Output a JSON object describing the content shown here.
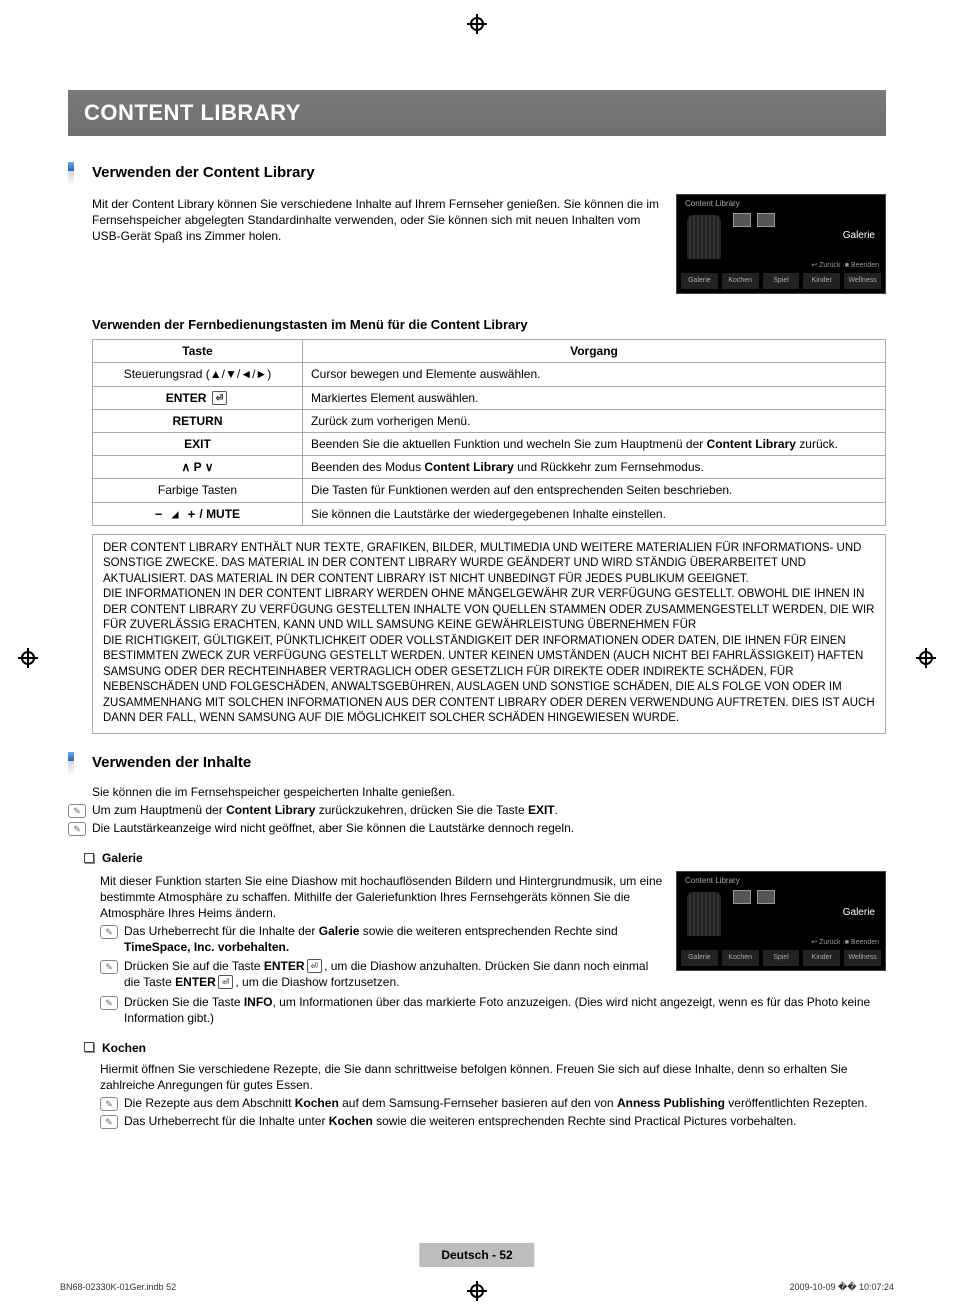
{
  "banner": "CONTENT LIBRARY",
  "sec1": {
    "title": "Verwenden der Content Library",
    "intro": "Mit der Content Library können Sie verschiedene Inhalte auf Ihrem Fernseher genießen. Sie können die im Fernsehspeicher abgelegten Standardinhalte verwenden, oder Sie können sich mit neuen Inhalten vom USB-Gerät Spaß ins Zimmer holen.",
    "tv_label": "Galerie",
    "tv_top_title": "Content Library",
    "tv_items": [
      "Galerie",
      "Kochen",
      "Spiel",
      "Kinder",
      "Wellness"
    ],
    "tv_meta": "↩ Zurück   ·■ Beenden"
  },
  "sub_heading_remote": "Verwenden der Fernbedienungstasten im Menü für die Content Library",
  "table": {
    "head": [
      "Taste",
      "Vorgang"
    ],
    "rows": [
      {
        "k": "Steuerungsrad (▲/▼/◄/►)",
        "v": "Cursor bewegen und Elemente auswählen."
      },
      {
        "k": "ENTER ⏎",
        "v": "Markiertes Element auswählen."
      },
      {
        "k": "RETURN",
        "v": "Zurück zum vorherigen Menü."
      },
      {
        "k": "EXIT",
        "v_html": [
          "Beenden Sie die aktuellen Funktion und wecheln Sie zum Hauptmenü der ",
          "Content Library",
          " zurück."
        ]
      },
      {
        "k": "∧ P ∨",
        "v_html": [
          "Beenden des Modus ",
          "Content Library",
          " und Rückkehr zum Fernsehmodus."
        ]
      },
      {
        "k": "Farbige Tasten",
        "v": "Die Tasten für Funktionen werden auf den entsprechenden Seiten beschrieben."
      },
      {
        "k": "− ◢ + / MUTE",
        "v": "Sie können die Lautstärke der wiedergegebenen Inhalte einstellen."
      }
    ]
  },
  "legal": "DER CONTENT LIBRARY ENTHÄLT NUR TEXTE, GRAFIKEN, BILDER, MULTIMEDIA UND WEITERE MATERIALIEN FÜR INFORMATIONS- UND SONSTIGE ZWECKE. DAS MATERIAL IN DER CONTENT LIBRARY WURDE GEÄNDERT UND WIRD STÄNDIG ÜBERARBEITET UND AKTUALISIERT. DAS MATERIAL IN DER CONTENT LIBRARY IST NICHT UNBEDINGT FÜR JEDES PUBLIKUM GEEIGNET.\nDIE INFORMATIONEN IN DER CONTENT LIBRARY WERDEN OHNE MÄNGELGEWÄHR ZUR VERFÜGUNG GESTELLT. OBWOHL DIE IHNEN IN DER CONTENT LIBRARY ZU VERFÜGUNG GESTELLTEN INHALTE VON QUELLEN STAMMEN ODER ZUSAMMENGESTELLT WERDEN, DIE WIR FÜR ZUVERLÄSSIG ERACHTEN, KANN UND WILL SAMSUNG KEINE GEWÄHRLEISTUNG ÜBERNEHMEN FÜR\nDIE RICHTIGKEIT, GÜLTIGKEIT, PÜNKTLICHKEIT ODER VOLLSTÄNDIGKEIT DER INFORMATIONEN ODER DATEN, DIE IHNEN FÜR EINEN BESTIMMTEN ZWECK ZUR VERFÜGUNG GESTELLT WERDEN. UNTER KEINEN UMSTÄNDEN (AUCH NICHT BEI FAHRLÄSSIGKEIT) HAFTEN SAMSUNG ODER DER RECHTEINHABER VERTRAGLICH ODER GESETZLICH FÜR DIREKTE ODER INDIREKTE SCHÄDEN, FÜR NEBENSCHÄDEN UND FOLGESCHÄDEN, ANWALTSGEBÜHREN, AUSLAGEN UND SONSTIGE SCHÄDEN, DIE ALS FOLGE VON ODER IM ZUSAMMENHANG MIT SOLCHEN INFORMATIONEN AUS DER CONTENT LIBRARY ODER DEREN VERWENDUNG AUFTRETEN. DIES IST AUCH DANN DER FALL, WENN SAMSUNG AUF DIE MÖGLICHKEIT SOLCHER SCHÄDEN HINGEWIESEN WURDE.",
  "sec2": {
    "title": "Verwenden der Inhalte",
    "intro": "Sie können die im Fernsehspeicher gespeicherten Inhalte genießen.",
    "n1_pre": "Um zum Hauptmenü der ",
    "n1_b1": "Content Library",
    "n1_mid": " zurückzukehren, drücken Sie die Taste ",
    "n1_b2": "EXIT",
    "n1_post": ".",
    "n2": "Die Lautstärkeanzeige wird nicht geöffnet, aber Sie können die Lautstärke dennoch regeln."
  },
  "galerie": {
    "title": "Galerie",
    "p1": "Mit dieser Funktion starten Sie eine Diashow mit hochauflösenden Bildern und Hintergrundmusik, um eine bestimmte Atmosphäre zu schaffen. Mithilfe der Galeriefunktion Ihres Fernsehgeräts können Sie die Atmosphäre Ihres Heims ändern.",
    "n1_pre": "Das Urheberrecht für die Inhalte der ",
    "n1_b1": "Galerie",
    "n1_mid": " sowie die weiteren entsprechenden Rechte sind ",
    "n1_b2": "TimeSpace, Inc. vorbehalten.",
    "n2_pre": "Drücken Sie auf die Taste ",
    "n2_b1": "ENTER",
    "n2_mid": ", um die Diashow anzuhalten. Drücken Sie dann noch einmal die Taste ",
    "n2_b2": "ENTER",
    "n2_post": ", um die Diashow fortzusetzen.",
    "n3_pre": "Drücken Sie die Taste ",
    "n3_b1": "INFO",
    "n3_post": ", um Informationen über das markierte Foto anzuzeigen. (Dies wird nicht angezeigt, wenn es für das Photo keine Information gibt.)",
    "tv_label": "Galerie"
  },
  "kochen": {
    "title": "Kochen",
    "p1": "Hiermit öffnen Sie verschiedene Rezepte, die Sie dann schrittweise befolgen können. Freuen Sie sich auf diese Inhalte, denn so erhalten Sie zahlreiche Anregungen für gutes Essen.",
    "n1_pre": "Die Rezepte aus dem Abschnitt ",
    "n1_b1": "Kochen",
    "n1_mid": " auf dem Samsung-Fernseher basieren auf den von ",
    "n1_b2": "Anness Publishing",
    "n1_post": " veröffentlichten Rezepten.",
    "n2_pre": "Das Urheberrecht für die Inhalte unter ",
    "n2_b1": "Kochen",
    "n2_post": " sowie die weiteren entsprechenden Rechte sind Practical Pictures vorbehalten."
  },
  "footer": "Deutsch - 52",
  "stamp_left": "BN68-02330K-01Ger.indb   52",
  "stamp_right": "2009-10-09   �� 10:07:24"
}
